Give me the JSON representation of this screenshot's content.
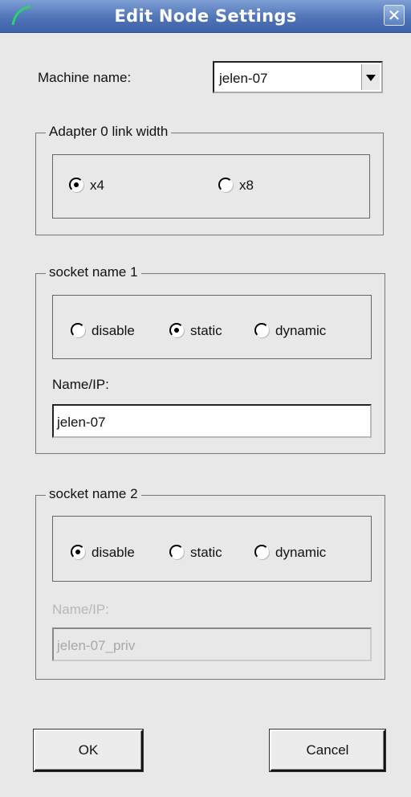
{
  "window": {
    "title": "Edit Node Settings",
    "close_label": "✕"
  },
  "machine": {
    "label": "Machine name:",
    "selected": "jelen-07"
  },
  "adapter": {
    "legend": "Adapter 0 link width",
    "options": [
      {
        "label": "x4",
        "selected": true
      },
      {
        "label": "x8",
        "selected": false
      }
    ]
  },
  "socket1": {
    "legend": "socket name 1",
    "options": [
      {
        "label": "disable",
        "selected": false
      },
      {
        "label": "static",
        "selected": true
      },
      {
        "label": "dynamic",
        "selected": false
      }
    ],
    "name_label": "Name/IP:",
    "name_value": "jelen-07",
    "enabled": true
  },
  "socket2": {
    "legend": "socket name 2",
    "options": [
      {
        "label": "disable",
        "selected": true
      },
      {
        "label": "static",
        "selected": false
      },
      {
        "label": "dynamic",
        "selected": false
      }
    ],
    "name_label": "Name/IP:",
    "name_value": "jelen-07_priv",
    "enabled": false
  },
  "buttons": {
    "ok": "OK",
    "cancel": "Cancel"
  }
}
